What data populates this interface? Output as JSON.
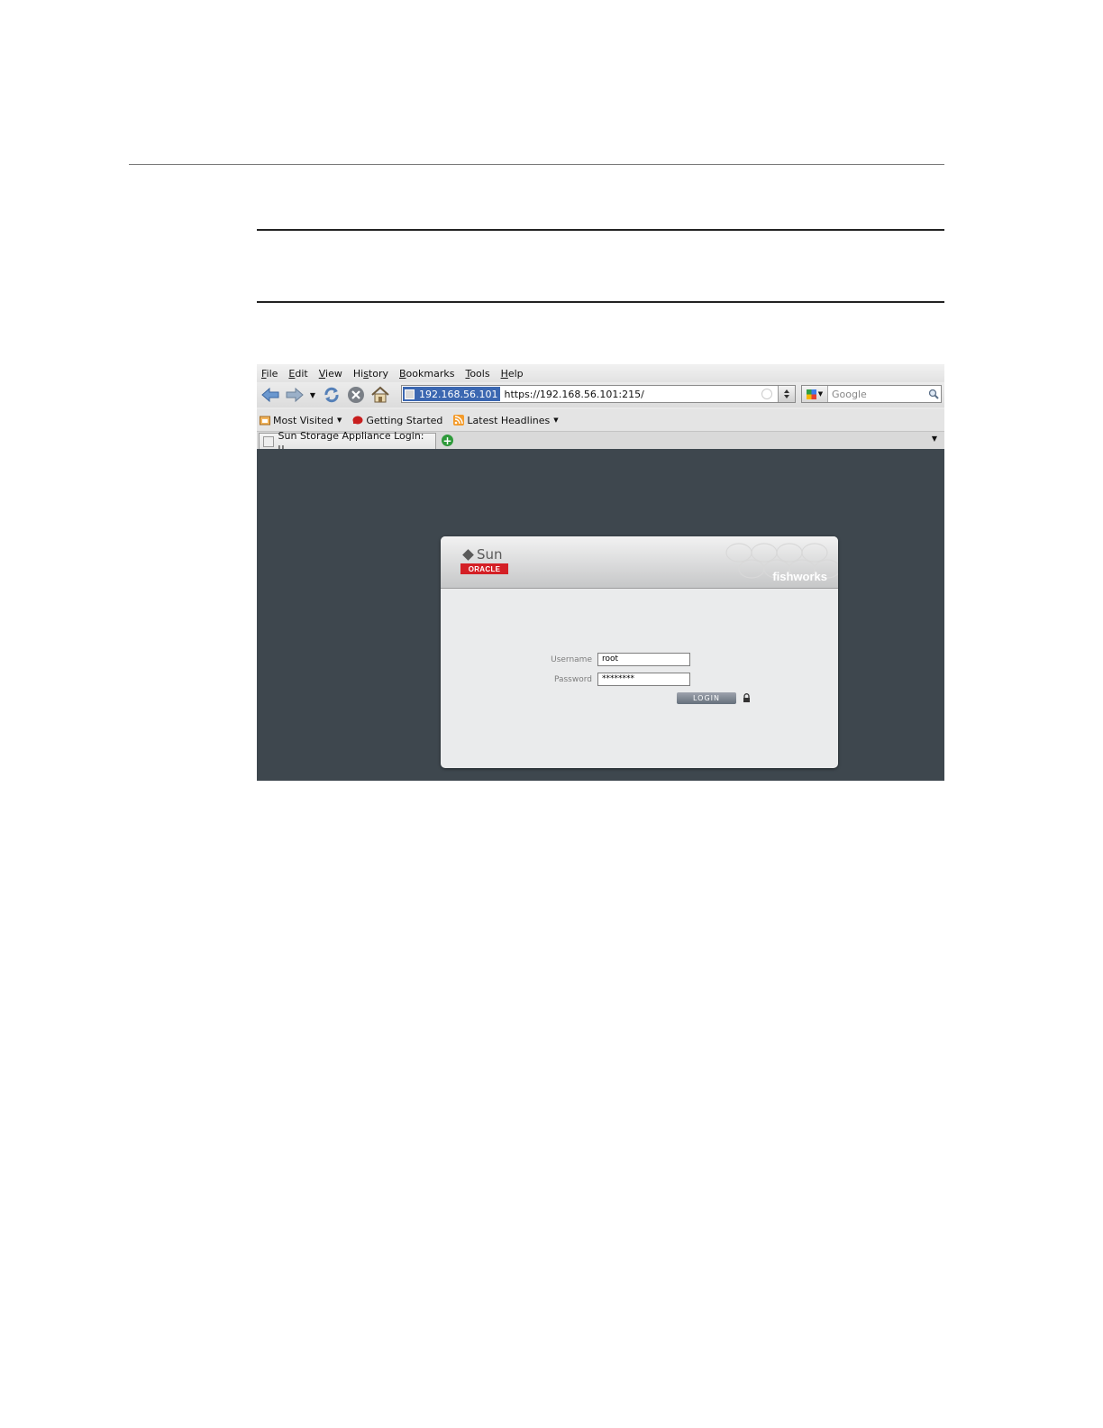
{
  "browser": {
    "menu": [
      "File",
      "Edit",
      "View",
      "History",
      "Bookmarks",
      "Tools",
      "Help"
    ],
    "menu_mnemonic_indices": [
      0,
      0,
      0,
      2,
      0,
      0,
      0
    ],
    "site_identity": "192.168.56.101",
    "url": "https://192.168.56.101:215/",
    "search_placeholder": "Google",
    "bookmarks": [
      {
        "label": "Most Visited",
        "icon": "most-visited-icon",
        "dropdown": true
      },
      {
        "label": "Getting Started",
        "icon": "getting-started-icon",
        "dropdown": false
      },
      {
        "label": "Latest Headlines",
        "icon": "rss-icon",
        "dropdown": true
      }
    ],
    "tab_title": "Sun Storage Appliance Login: u..."
  },
  "login": {
    "brand_sun": "Sun",
    "brand_oracle": "ORACLE",
    "product": "fishworks",
    "username_label": "Username",
    "username_value": "root",
    "password_label": "Password",
    "password_value": "********",
    "login_button": "LOGIN"
  },
  "colors": {
    "page_background": "#3e474e",
    "oracle_red": "#d41f25",
    "url_identity_blue": "#3b67b1"
  }
}
